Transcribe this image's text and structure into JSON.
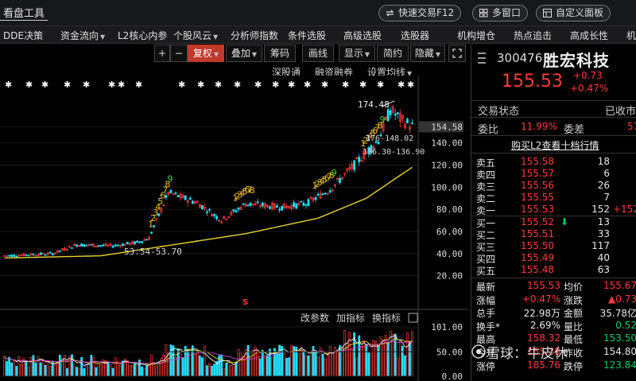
{
  "topbar": {
    "title": "看盘工具",
    "quick_trade": "快速交易F12",
    "multi_window": "多窗口",
    "custom_panel": "自定义面板"
  },
  "menu": [
    "DDE决策",
    "资金流向",
    "L2核心内参",
    "个股风云",
    "分析师指数",
    "条件选股",
    "高级选股",
    "选股器",
    "机构增仓",
    "热点追击",
    "高成长性",
    "机"
  ],
  "toolbar": {
    "plus": "+",
    "minus": "−",
    "fuquan": "复权",
    "overlay": "叠加",
    "chip": "筹码",
    "draw": "画线",
    "display": "显示",
    "simple": "简约",
    "hide": "隐藏"
  },
  "chart_options": {
    "sgt": "深股通",
    "margin": "融资融券",
    "ma_settings": "设置均线"
  },
  "chart_labels": {
    "high": "174.48",
    "low": "53.54-53.70",
    "range_a": "176-148.02",
    "range_b": "136.30-136.90",
    "s_marker": "S"
  },
  "price_axis": [
    "154.58",
    "140.00",
    "120.00",
    "100.00",
    "80.00",
    "60.00",
    "40.00",
    "20.00"
  ],
  "volume_axis": [
    "101.00",
    "50.00",
    "0.00"
  ],
  "indicator_tabs": [
    "改参数",
    "加指标",
    "换指标"
  ],
  "colors": {
    "up": "#ff3b3b",
    "down": "#1ee0ff",
    "ma": "#e8d430",
    "signal": "#f0c020",
    "positive_text": "#ff3b3b",
    "negative_text": "#00d060"
  },
  "stock": {
    "code": "300476",
    "name": "胜宏科技",
    "price": "155.53",
    "change": "+0.73",
    "change_pct": "+0.47%",
    "status_label": "交易状态",
    "status_value": "已收市",
    "weibi_label": "委比",
    "weibi_value": "11.99%",
    "weicha_label": "委差",
    "weicha_value": "57",
    "l2_link": "购买L2查看十档行情"
  },
  "orderbook": {
    "sell": [
      {
        "label": "卖五",
        "price": "155.58",
        "vol": "18",
        "extra": ""
      },
      {
        "label": "卖四",
        "price": "155.57",
        "vol": "6",
        "extra": ""
      },
      {
        "label": "卖三",
        "price": "155.56",
        "vol": "26",
        "extra": ""
      },
      {
        "label": "卖二",
        "price": "155.55",
        "vol": "7",
        "extra": ""
      },
      {
        "label": "卖一",
        "price": "155.53",
        "vol": "152",
        "extra": "+152"
      }
    ],
    "buy": [
      {
        "label": "买一",
        "price": "155.52",
        "vol": "13",
        "extra": ""
      },
      {
        "label": "买二",
        "price": "155.51",
        "vol": "33",
        "extra": ""
      },
      {
        "label": "买三",
        "price": "155.50",
        "vol": "117",
        "extra": ""
      },
      {
        "label": "买四",
        "price": "155.49",
        "vol": "40",
        "extra": ""
      },
      {
        "label": "买五",
        "price": "155.48",
        "vol": "63",
        "extra": ""
      }
    ]
  },
  "stats": [
    {
      "l1": "最新",
      "v1": "155.53",
      "l2": "均价",
      "v2": "155.67"
    },
    {
      "l1": "涨幅",
      "v1": "+0.47%",
      "l2": "涨跌",
      "v2": "▲0.73"
    },
    {
      "l1": "总手",
      "v1": "22.98万",
      "l2": "金额",
      "v2": "35.78亿"
    },
    {
      "l1": "换手*",
      "v1": "2.69%",
      "l2": "量比",
      "v2": "0.52"
    },
    {
      "l1": "最高",
      "v1": "158.32",
      "l2": "最低",
      "v2": "153.50"
    },
    {
      "l1": "今开",
      "v1": "155.38",
      "l2": "昨收",
      "v2": "154.80"
    },
    {
      "l1": "涨停",
      "v1": "185.76",
      "l2": "跌停",
      "v2": "123.84"
    }
  ],
  "watermark": "雪球：牛皮休"
}
